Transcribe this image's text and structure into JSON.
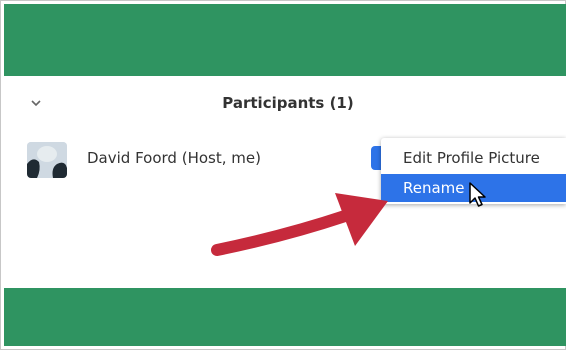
{
  "participants_panel": {
    "title": "Participants (1)",
    "collapse_icon": "chevron-down-icon"
  },
  "participant": {
    "name": "David Foord (Host, me)",
    "avatar_icon": "avatar-image"
  },
  "context_menu": {
    "items": [
      {
        "label": "Edit Profile Picture"
      },
      {
        "label": "Rename"
      }
    ],
    "highlight_color": "#2d73e8"
  },
  "colors": {
    "band": "#2f9461",
    "annotation_arrow": "#c62a3c"
  }
}
